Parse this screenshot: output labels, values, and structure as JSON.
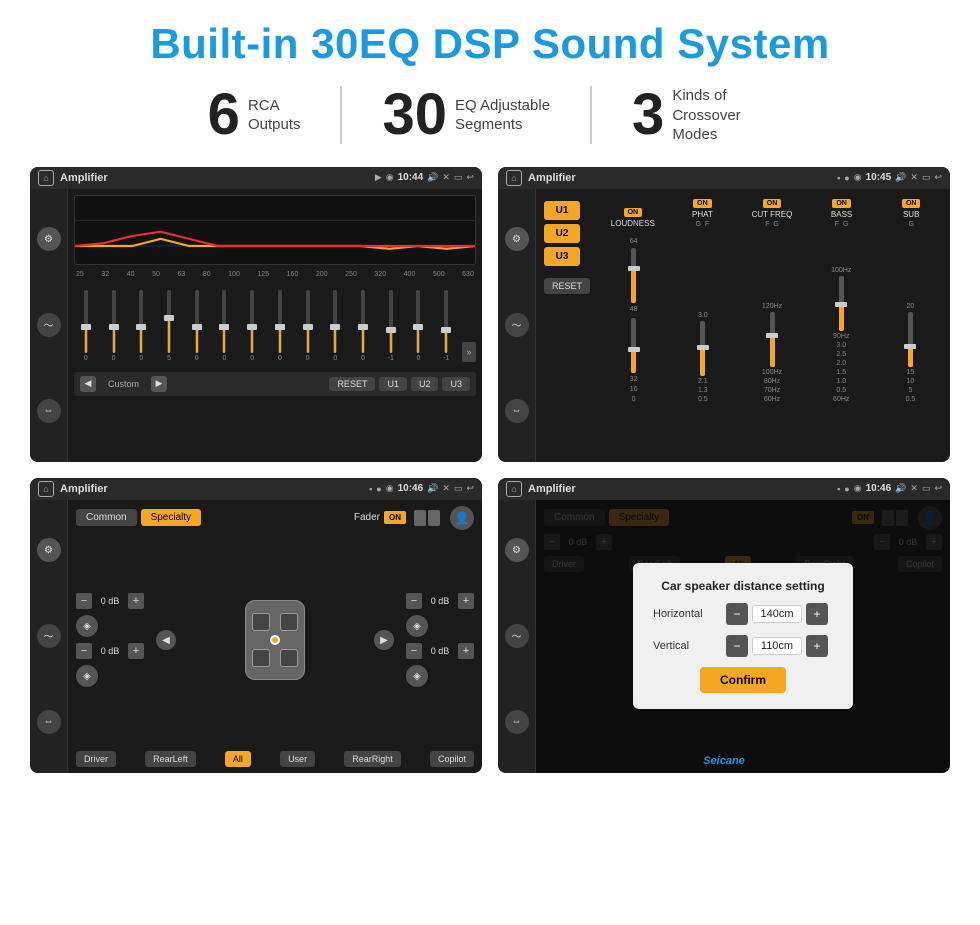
{
  "page": {
    "title": "Built-in 30EQ DSP Sound System",
    "watermark": "Seicane"
  },
  "stats": [
    {
      "number": "6",
      "label": "RCA\nOutputs"
    },
    {
      "number": "30",
      "label": "EQ Adjustable\nSegments"
    },
    {
      "number": "3",
      "label": "Kinds of\nCrossover Modes"
    }
  ],
  "screens": {
    "eq": {
      "title": "Amplifier",
      "time": "10:44",
      "freqs": [
        "25",
        "32",
        "40",
        "50",
        "63",
        "80",
        "100",
        "125",
        "160",
        "200",
        "250",
        "320",
        "400",
        "500",
        "630"
      ],
      "values": [
        "0",
        "0",
        "0",
        "5",
        "0",
        "0",
        "0",
        "0",
        "0",
        "0",
        "0",
        "-1",
        "0",
        "-1"
      ],
      "buttons": [
        "Custom",
        "RESET",
        "U1",
        "U2",
        "U3"
      ]
    },
    "amp": {
      "title": "Amplifier",
      "time": "10:45",
      "presets": [
        "U1",
        "U2",
        "U3"
      ],
      "channels": [
        "LOUDNESS",
        "PHAT",
        "CUT FREQ",
        "BASS",
        "SUB"
      ],
      "reset": "RESET"
    },
    "fader": {
      "title": "Amplifier",
      "time": "10:46",
      "tabs": [
        "Common",
        "Specialty"
      ],
      "fader_label": "Fader",
      "on_label": "ON",
      "db_values": [
        "0 dB",
        "0 dB",
        "0 dB",
        "0 dB"
      ],
      "buttons": [
        "Driver",
        "RearLeft",
        "All",
        "User",
        "RearRight",
        "Copilot"
      ]
    },
    "distance": {
      "title": "Amplifier",
      "time": "10:46",
      "tabs": [
        "Common",
        "Specialty"
      ],
      "modal": {
        "title": "Car speaker distance setting",
        "horizontal_label": "Horizontal",
        "horizontal_value": "140cm",
        "vertical_label": "Vertical",
        "vertical_value": "110cm",
        "confirm_btn": "Confirm"
      },
      "buttons": [
        "Driver",
        "RearLeft",
        "RearRight",
        "Copilot"
      ]
    }
  }
}
